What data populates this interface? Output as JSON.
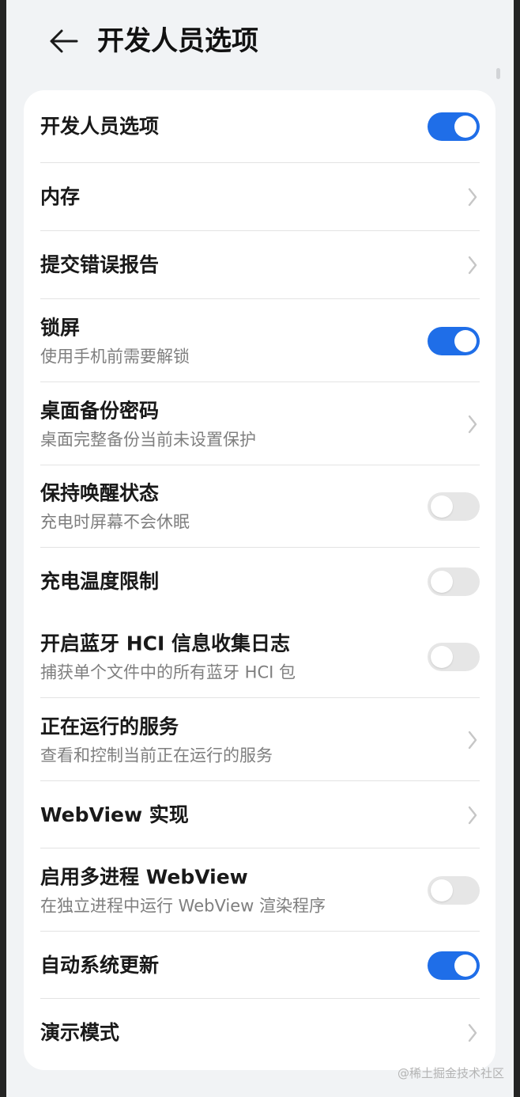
{
  "header": {
    "title": "开发人员选项",
    "back_icon": "arrow-left-icon"
  },
  "items": [
    {
      "title": "开发人员选项",
      "control": "toggle",
      "checked": true
    },
    {
      "title": "内存",
      "control": "chevron"
    },
    {
      "title": "提交错误报告",
      "control": "chevron"
    },
    {
      "title": "锁屏",
      "subtitle": "使用手机前需要解锁",
      "control": "toggle",
      "checked": true
    },
    {
      "title": "桌面备份密码",
      "subtitle": "桌面完整备份当前未设置保护",
      "control": "chevron"
    },
    {
      "title": "保持唤醒状态",
      "subtitle": "充电时屏幕不会休眠",
      "control": "toggle",
      "checked": false
    },
    {
      "title": "充电温度限制",
      "control": "toggle",
      "checked": false
    },
    {
      "title": "开启蓝牙 HCI 信息收集日志",
      "subtitle": "捕获单个文件中的所有蓝牙 HCI 包",
      "control": "toggle",
      "checked": false
    },
    {
      "title": "正在运行的服务",
      "subtitle": "查看和控制当前正在运行的服务",
      "control": "chevron"
    },
    {
      "title": "WebView 实现",
      "control": "chevron"
    },
    {
      "title": "启用多进程 WebView",
      "subtitle": "在独立进程中运行 WebView 渲染程序",
      "control": "toggle",
      "checked": false
    },
    {
      "title": "自动系统更新",
      "control": "toggle",
      "checked": true
    },
    {
      "title": "演示模式",
      "control": "chevron"
    }
  ],
  "colors": {
    "accent": "#1f6ee8",
    "toggle_off": "#e6e6e6",
    "background": "#f1f3f5"
  },
  "watermark": "@稀土掘金技术社区"
}
